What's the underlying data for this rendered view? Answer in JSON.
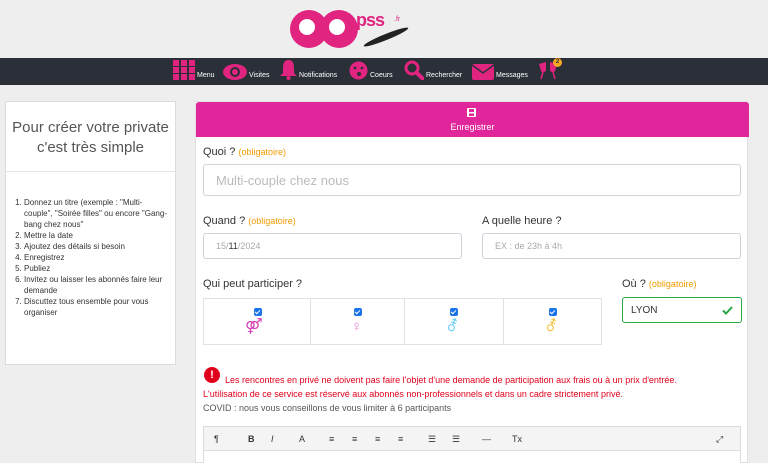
{
  "nav": {
    "items": [
      {
        "label": "Menu",
        "icon": "grid-icon"
      },
      {
        "label": "Visites",
        "icon": "eye-icon"
      },
      {
        "label": "Notifications",
        "icon": "bell-icon"
      },
      {
        "label": "Coeurs",
        "icon": "kiss-icon"
      },
      {
        "label": "Rechercher",
        "icon": "search-icon"
      },
      {
        "label": "Messages",
        "icon": "envelope-icon"
      },
      {
        "label": "",
        "icon": "cheers-icon",
        "badge": "2"
      }
    ],
    "accent": "#e0247f"
  },
  "left": {
    "title": "Pour créer votre private c'est très simple",
    "steps": [
      "Donnez un titre (exemple : \"Multi-couple\", \"Soirée filles\" ou encore \"Gang-bang chez nous\"",
      "Mettre la date",
      "Ajoutez des détails si besoin",
      "Enregistrez",
      "Publiez",
      "Invitez ou laisser les abonnés faire leur demande",
      "Discuttez tous ensemble pour vous organiser"
    ]
  },
  "form": {
    "save_label": "Enregistrer",
    "quoi_label": "Quoi ?",
    "required": "(obligatoire)",
    "quoi_placeholder": "Multi-couple chez nous",
    "quand_label": "Quand ?",
    "date_day": "15",
    "date_month": "11",
    "date_year": "2024",
    "heure_label": "A quelle heure ?",
    "heure_placeholder": "EX : de 23h à 4h",
    "participants_label": "Qui peut participer ?",
    "participants": [
      {
        "symbol": "⚤",
        "color": "#d63db5",
        "checked": true
      },
      {
        "symbol": "♀",
        "color": "#f08ad0",
        "checked": true
      },
      {
        "symbol": "⚦",
        "color": "#6ecff6",
        "checked": true
      },
      {
        "symbol": "⚦",
        "color": "#f5c242",
        "checked": true
      }
    ],
    "ou_label": "Où ?",
    "ou_value": "LYON",
    "warning_1": "Les rencontres en privé ne doivent pas faire l'objet d'une demande de participation aux frais ou à un prix d'entrée.",
    "warning_2": "L'utilisation de ce service est réservé aux abonnés non-professionnels et dans un cadre strictement privé.",
    "covid": "COVID : nous vous conseillons de vous limiter à 6 participants"
  },
  "editor": {
    "tools": [
      "¶",
      "B",
      "I",
      "A",
      "≡",
      "≡",
      "≡",
      "≡",
      "☰",
      "☰",
      "—",
      "Tx",
      "⤢"
    ]
  }
}
